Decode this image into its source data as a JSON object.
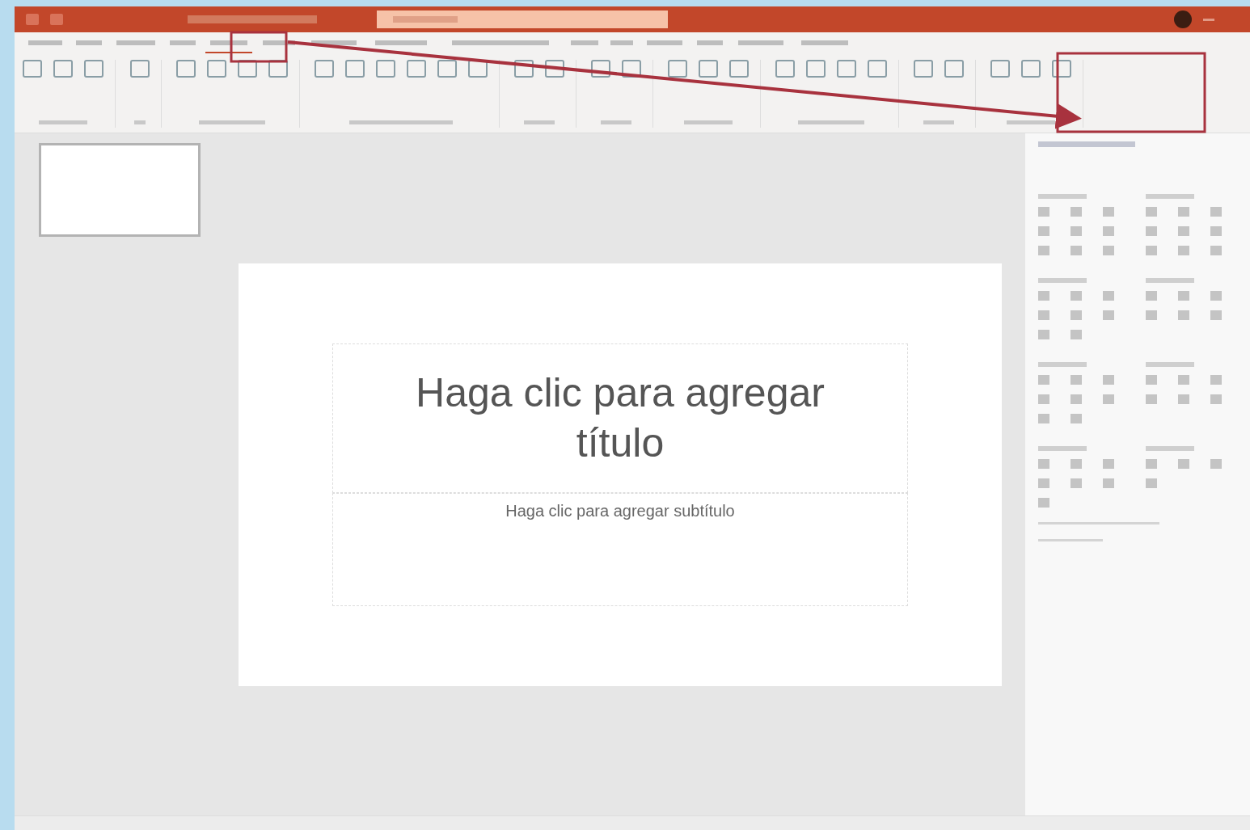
{
  "tabs": [
    {
      "selected": false
    },
    {
      "selected": false
    },
    {
      "selected": false
    },
    {
      "selected": false
    },
    {
      "selected": true
    },
    {
      "selected": false
    },
    {
      "selected": false
    },
    {
      "selected": false
    },
    {
      "selected": false
    },
    {
      "selected": false
    },
    {
      "selected": false
    },
    {
      "selected": false
    },
    {
      "selected": false
    },
    {
      "selected": false
    },
    {
      "selected": false
    }
  ],
  "thumbnails": [
    {
      "selected": true
    }
  ],
  "slide": {
    "title": "Haga clic para agregar título",
    "subtitle": "Haga clic para agregar subtítulo"
  }
}
